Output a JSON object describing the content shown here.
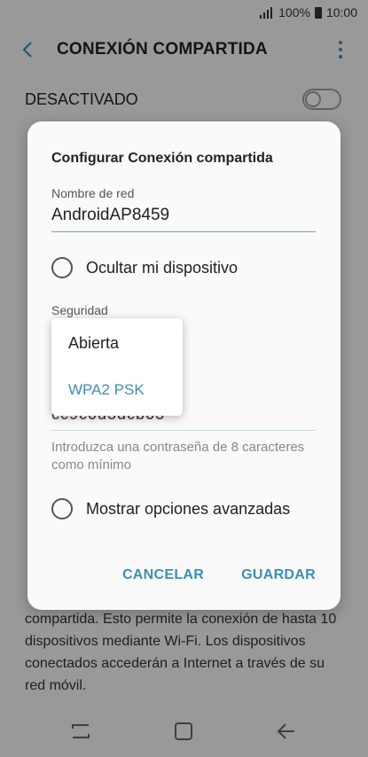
{
  "status": {
    "battery": "100%",
    "time": "10:00"
  },
  "header": {
    "title": "CONEXIÓN COMPARTIDA"
  },
  "master_switch": {
    "label": "DESACTIVADO",
    "on": false
  },
  "background_description": "compartida. Esto permite la conexión de hasta 10 dispositivos mediante Wi-Fi. Los dispositivos conectados accederán a Internet a través de su red móvil.",
  "dialog": {
    "title": "Configurar Conexión compartida",
    "network_name_label": "Nombre de red",
    "network_name_value": "AndroidAP8459",
    "hide_device_label": "Ocultar mi dispositivo",
    "security_label": "Seguridad",
    "password_value": "cc9c0d3dcb03",
    "password_hint": "Introduzca una contraseña de 8 caracteres como mínimo",
    "advanced_label": "Mostrar opciones avanzadas",
    "cancel_label": "CANCELAR",
    "save_label": "GUARDAR"
  },
  "security_dropdown": {
    "options": [
      "Abierta",
      "WPA2 PSK"
    ],
    "selected": "WPA2 PSK"
  },
  "colors": {
    "accent": "#3a8fb7",
    "scrim": "rgba(0,0,0,0.38)"
  },
  "icons": [
    "signal-icon",
    "battery-icon",
    "back-arrow-icon",
    "more-options-icon",
    "recents-icon",
    "home-icon",
    "back-nav-icon"
  ]
}
